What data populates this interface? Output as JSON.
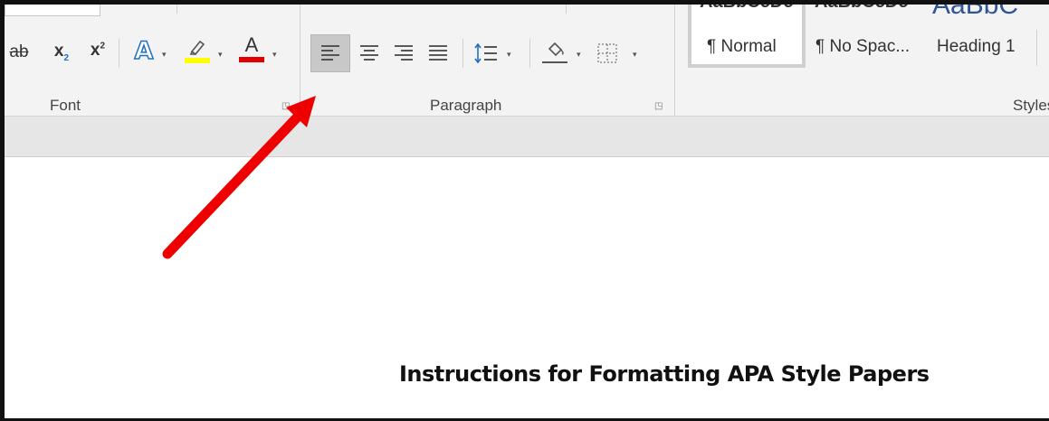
{
  "ribbon": {
    "groups": {
      "font": "Font",
      "paragraph": "Paragraph",
      "styles": "Styles"
    },
    "styles_gallery": {
      "preview_1": "AaBbCcDc",
      "preview_2": "AaBbCcDc",
      "preview_3": "AaBbC",
      "items": [
        "¶ Normal",
        "¶ No Spac...",
        "Heading 1"
      ]
    },
    "font_buttons": {
      "strikethrough": "ab",
      "subscript": "x",
      "subscript_mark": "2",
      "superscript": "x",
      "superscript_mark": "2",
      "text_effects": "A",
      "font_color": "A"
    },
    "colors": {
      "highlight": "#ffff00",
      "font_color": "#e00000",
      "heading_blue": "#2f5597",
      "arrow": "#ee0000"
    }
  },
  "document": {
    "title": "Instructions for Formatting APA Style Papers"
  }
}
